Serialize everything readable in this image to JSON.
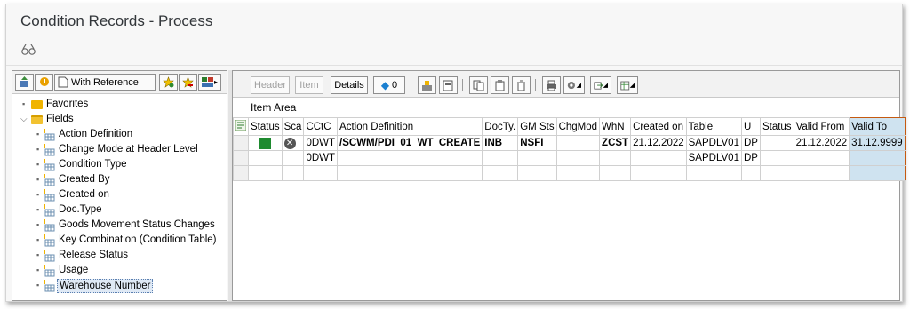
{
  "window": {
    "title": "Condition Records - Process"
  },
  "left_toolbar": {
    "with_reference_label": "With Reference"
  },
  "tree": {
    "items": [
      {
        "label": "Favorites",
        "level": 0,
        "kind": "folder"
      },
      {
        "label": "Fields",
        "level": 0,
        "kind": "folder-open"
      },
      {
        "label": "Action Definition",
        "level": 1,
        "kind": "field"
      },
      {
        "label": "Change Mode at Header Level",
        "level": 1,
        "kind": "field"
      },
      {
        "label": "Condition Type",
        "level": 1,
        "kind": "field"
      },
      {
        "label": "Created By",
        "level": 1,
        "kind": "field"
      },
      {
        "label": "Created on",
        "level": 1,
        "kind": "field"
      },
      {
        "label": "Doc.Type",
        "level": 1,
        "kind": "field"
      },
      {
        "label": "Goods Movement Status Changes",
        "level": 1,
        "kind": "field"
      },
      {
        "label": "Key Combination (Condition Table)",
        "level": 1,
        "kind": "field"
      },
      {
        "label": "Release Status",
        "level": 1,
        "kind": "field"
      },
      {
        "label": "Usage",
        "level": 1,
        "kind": "field"
      },
      {
        "label": "Warehouse Number",
        "level": 1,
        "kind": "field",
        "selected": true
      }
    ]
  },
  "right_toolbar": {
    "header_label": "Header",
    "item_label": "Item",
    "details_label": "Details",
    "counter_label": "0"
  },
  "item_area": {
    "title": "Item Area"
  },
  "grid": {
    "columns": [
      "Status",
      "Sca",
      "CCtC",
      "Action Definition",
      "DocTy.",
      "GM Sts",
      "ChgMod",
      "WhN",
      "Created on",
      "Table",
      "U",
      "Status",
      "Valid From",
      "Valid To"
    ],
    "rows": [
      [
        "",
        "",
        "0DWT",
        "/SCWM/PDI_01_WT_CREATE",
        "INB",
        "NSFI",
        "",
        "ZCST",
        "21.12.2022",
        "SAPDLV01",
        "DP",
        "",
        "21.12.2022",
        "31.12.9999"
      ],
      [
        "",
        "",
        "0DWT",
        "",
        "",
        "",
        "",
        "",
        "",
        "SAPDLV01",
        "DP",
        "",
        "",
        ""
      ],
      [
        "",
        "",
        "",
        "",
        "",
        "",
        "",
        "",
        "",
        "",
        "",
        "",
        "",
        ""
      ]
    ]
  },
  "colors": {
    "status_green": "#1e8a2f",
    "folder_yellow": "#f0b400",
    "valid_to_highlight": "#cfe3f0"
  }
}
